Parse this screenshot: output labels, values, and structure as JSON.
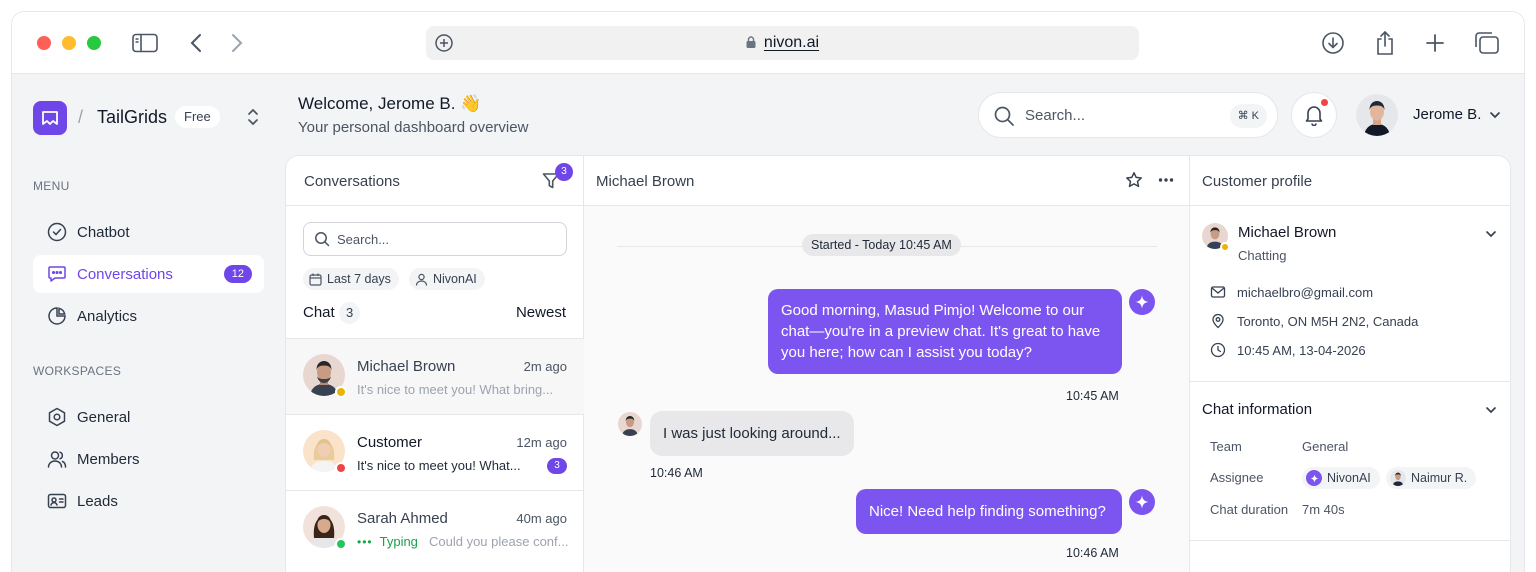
{
  "browser": {
    "url": "nivon.ai"
  },
  "brand": {
    "name": "TailGrids",
    "separator": "/",
    "plan": "Free"
  },
  "sidebar": {
    "menu_label": "MENU",
    "menu_items": [
      {
        "label": "Chatbot",
        "icon": "chatbot-icon"
      },
      {
        "label": "Conversations",
        "icon": "chat-bubbles-icon",
        "count": "12",
        "active": true
      },
      {
        "label": "Analytics",
        "icon": "pie-chart-icon"
      }
    ],
    "workspaces_label": "WORKSPACES",
    "workspace_items": [
      {
        "label": "General",
        "icon": "hexagon-icon"
      },
      {
        "label": "Members",
        "icon": "users-icon"
      },
      {
        "label": "Leads",
        "icon": "id-card-icon"
      }
    ]
  },
  "header": {
    "welcome": "Welcome, Jerome B. 👋",
    "subtitle": "Your personal dashboard overview",
    "search_placeholder": "Search...",
    "search_shortcut": "⌘ K",
    "user_name": "Jerome B."
  },
  "conversations": {
    "title": "Conversations",
    "filter_count": "3",
    "search_placeholder": "Search...",
    "chips": [
      "Last 7 days",
      "NivonAI"
    ],
    "chat_label": "Chat",
    "chat_count": "3",
    "sort": "Newest",
    "rows": [
      {
        "name": "Michael Brown",
        "time": "2m ago",
        "preview": "It's nice to meet you! What bring...",
        "status_color": "#eab308"
      },
      {
        "name": "Customer",
        "time": "12m ago",
        "preview": "It's nice to meet you! What...",
        "unread": "3",
        "status_color": "#ef4444"
      },
      {
        "name": "Sarah Ahmed",
        "time": "40m ago",
        "typing": "Typing",
        "preview": "Could you please conf...",
        "status_color": "#22c55e"
      }
    ]
  },
  "chat": {
    "contact": "Michael Brown",
    "started": "Started - Today 10:45 AM",
    "messages": [
      {
        "text": "Good morning, Masud Pimjo! Welcome to our chat—you're in a preview chat. It's great to have you here; how can I assist you today?",
        "time": "10:45 AM"
      },
      {
        "text": "I was just looking around...",
        "time": "10:46 AM"
      },
      {
        "text": "Nice! Need help finding something?",
        "time": "10:46 AM"
      }
    ]
  },
  "profile": {
    "title": "Customer profile",
    "name": "Michael Brown",
    "state": "Chatting",
    "email": "michaelbro@gmail.com",
    "location": "Toronto, ON M5H 2N2, Canada",
    "datetime": "10:45 AM, 13-04-2026",
    "chat_info_title": "Chat information",
    "team_label": "Team",
    "team_value": "General",
    "assignee_label": "Assignee",
    "assignees": [
      "NivonAI",
      "Naimur R."
    ],
    "duration_label": "Chat duration",
    "duration_value": "7m 40s"
  },
  "colors": {
    "accent": "#6f47e8",
    "bubble": "#7c55f0"
  }
}
